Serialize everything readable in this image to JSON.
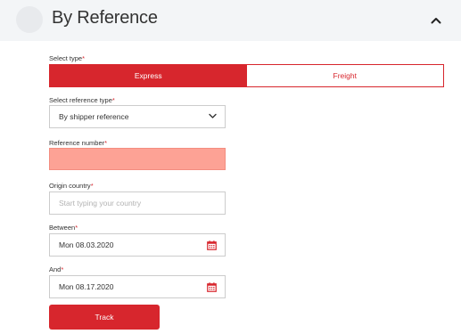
{
  "header": {
    "title": "By Reference",
    "collapse_icon": "chevron-up-icon"
  },
  "form": {
    "select_type": {
      "label": "Select type",
      "required_mark": "*",
      "options": [
        "Express",
        "Freight"
      ],
      "selected": "Express"
    },
    "reference_type": {
      "label": "Select reference type",
      "required_mark": "*",
      "value": "By shipper reference",
      "icon": "chevron-down-icon"
    },
    "reference_number": {
      "label": "Reference number",
      "required_mark": "*",
      "value": ""
    },
    "origin_country": {
      "label": "Origin country",
      "required_mark": "*",
      "placeholder": "Start typing your country"
    },
    "between": {
      "label": "Between",
      "required_mark": "*",
      "value": "Mon 08.03.2020",
      "icon": "calendar-icon"
    },
    "and": {
      "label": "And",
      "required_mark": "*",
      "value": "Mon 08.17.2020",
      "icon": "calendar-icon"
    },
    "track_button": "Track"
  },
  "colors": {
    "accent": "#d7262d",
    "error_fill": "#fda295",
    "header_bg": "#f3f5f7"
  }
}
